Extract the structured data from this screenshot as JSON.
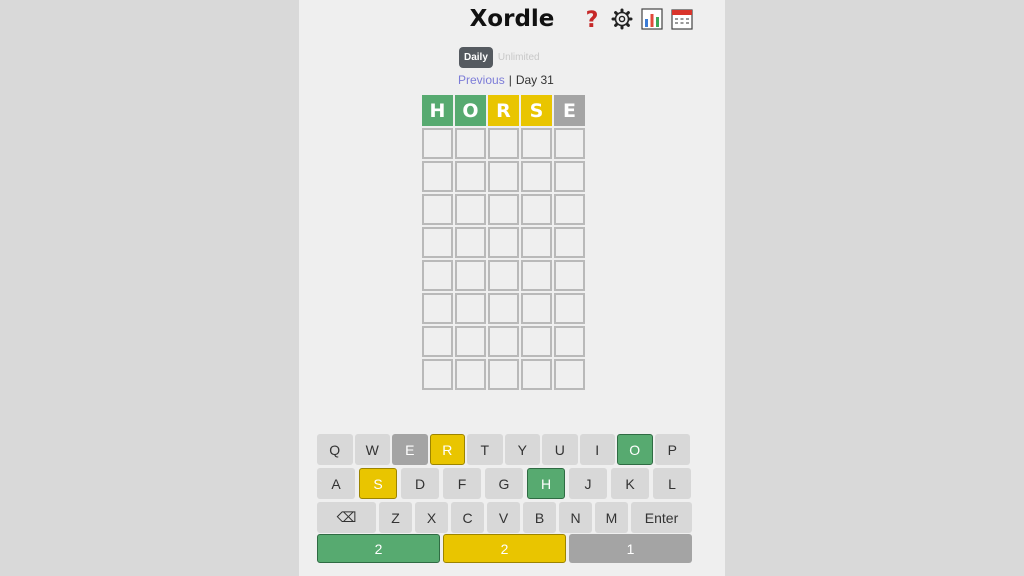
{
  "app": {
    "title": "Xordle"
  },
  "icons": [
    "question-mark-icon",
    "gear-icon",
    "bar-chart-icon",
    "calendar-icon"
  ],
  "modes": {
    "daily": "Daily",
    "unlimited": "Unlimited",
    "active": "daily"
  },
  "nav": {
    "previous": "Previous",
    "separator": "|",
    "day": "Day 31"
  },
  "board": {
    "rows": 9,
    "cols": 5,
    "guesses": [
      [
        {
          "letter": "H",
          "state": "correct"
        },
        {
          "letter": "O",
          "state": "correct"
        },
        {
          "letter": "R",
          "state": "present"
        },
        {
          "letter": "S",
          "state": "present"
        },
        {
          "letter": "E",
          "state": "absent"
        }
      ]
    ]
  },
  "keyboard": {
    "rows": [
      [
        {
          "label": "Q",
          "state": ""
        },
        {
          "label": "W",
          "state": ""
        },
        {
          "label": "E",
          "state": "absent"
        },
        {
          "label": "R",
          "state": "present"
        },
        {
          "label": "T",
          "state": ""
        },
        {
          "label": "Y",
          "state": ""
        },
        {
          "label": "U",
          "state": ""
        },
        {
          "label": "I",
          "state": ""
        },
        {
          "label": "O",
          "state": "correct"
        },
        {
          "label": "P",
          "state": ""
        }
      ],
      [
        {
          "label": "A",
          "state": ""
        },
        {
          "label": "S",
          "state": "present"
        },
        {
          "label": "D",
          "state": ""
        },
        {
          "label": "F",
          "state": ""
        },
        {
          "label": "G",
          "state": ""
        },
        {
          "label": "H",
          "state": "correct"
        },
        {
          "label": "J",
          "state": ""
        },
        {
          "label": "K",
          "state": ""
        },
        {
          "label": "L",
          "state": ""
        }
      ],
      [
        {
          "label": "⌫",
          "state": "",
          "name": "backspace-key"
        },
        {
          "label": "Z",
          "state": ""
        },
        {
          "label": "X",
          "state": ""
        },
        {
          "label": "C",
          "state": ""
        },
        {
          "label": "V",
          "state": ""
        },
        {
          "label": "B",
          "state": ""
        },
        {
          "label": "N",
          "state": ""
        },
        {
          "label": "M",
          "state": ""
        },
        {
          "label": "Enter",
          "state": "",
          "name": "enter-key"
        }
      ]
    ]
  },
  "counts": [
    {
      "value": "2",
      "state": "green"
    },
    {
      "value": "2",
      "state": "yellow"
    },
    {
      "value": "1",
      "state": "grey"
    }
  ],
  "colors": {
    "correct": "#57aa70",
    "present": "#e9c500",
    "absent": "#a4a4a4",
    "key": "#d8d8d8",
    "background": "#efefef"
  }
}
